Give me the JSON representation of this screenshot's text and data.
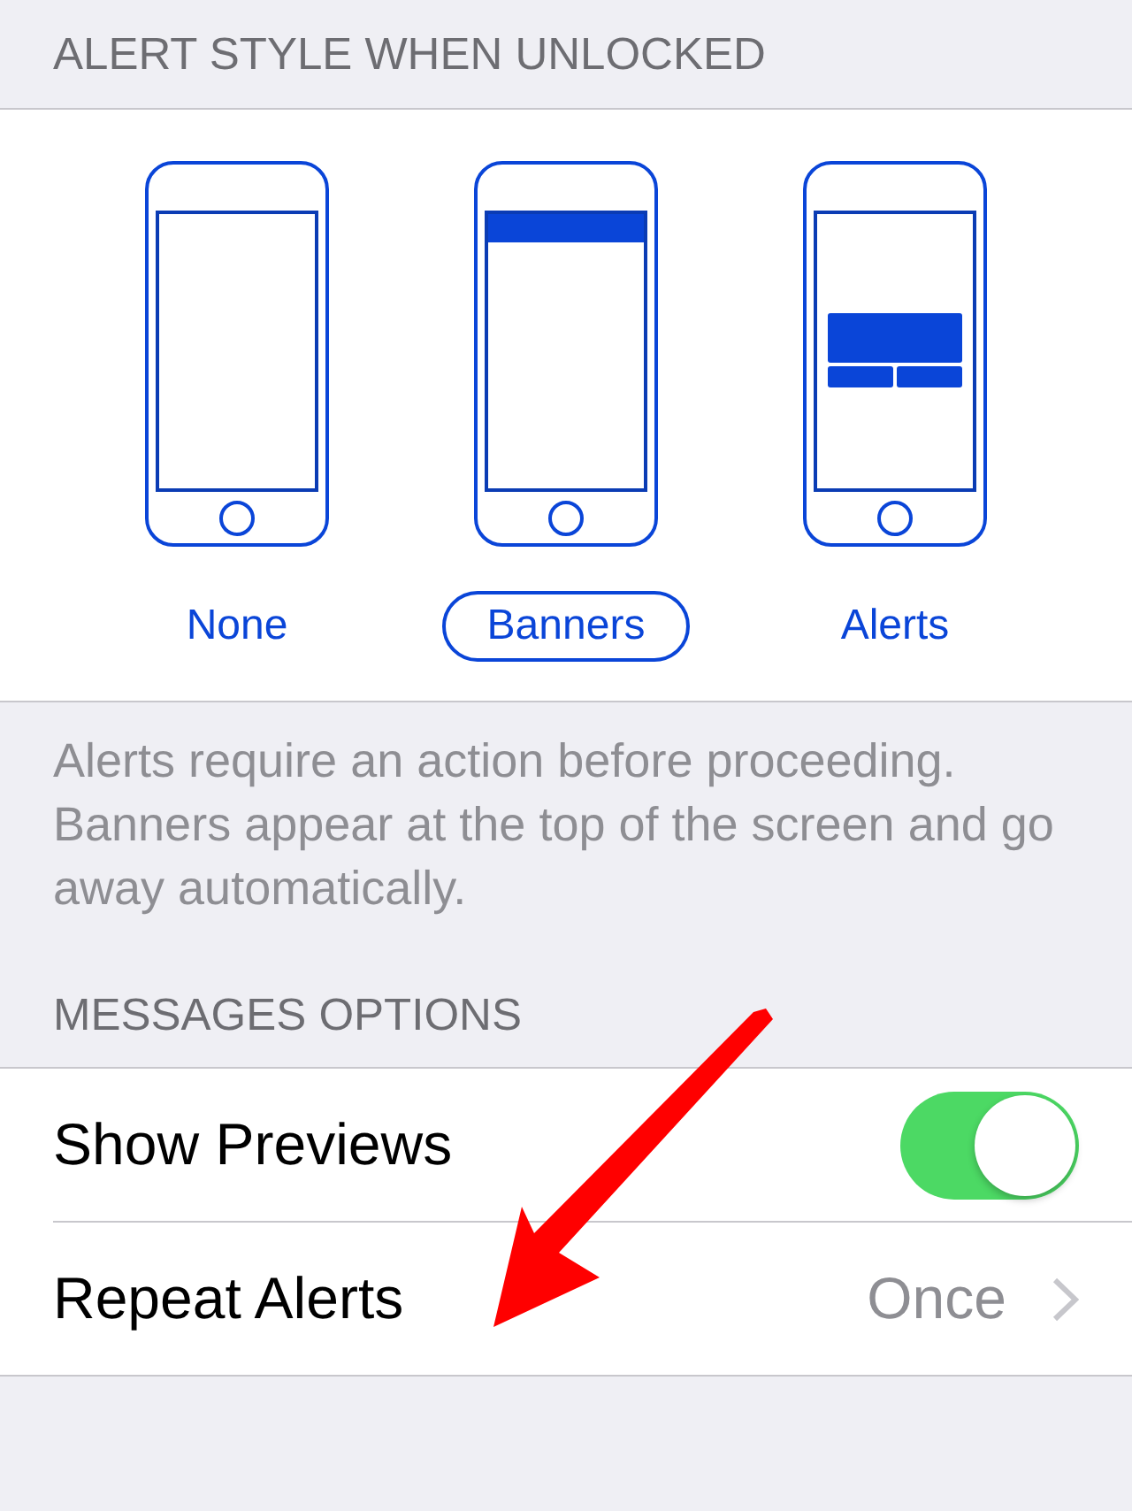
{
  "alert_style": {
    "header": "ALERT STYLE WHEN UNLOCKED",
    "options": [
      {
        "kind": "none",
        "label": "None",
        "selected": false
      },
      {
        "kind": "banners",
        "label": "Banners",
        "selected": true
      },
      {
        "kind": "alerts",
        "label": "Alerts",
        "selected": false
      }
    ],
    "footer": "Alerts require an action before proceeding. Banners appear at the top of the screen and go away automatically."
  },
  "messages_options": {
    "header": "MESSAGES OPTIONS",
    "rows": [
      {
        "kind": "toggle",
        "label": "Show Previews",
        "on": true
      },
      {
        "kind": "disclosure",
        "label": "Repeat Alerts",
        "value": "Once"
      }
    ]
  }
}
